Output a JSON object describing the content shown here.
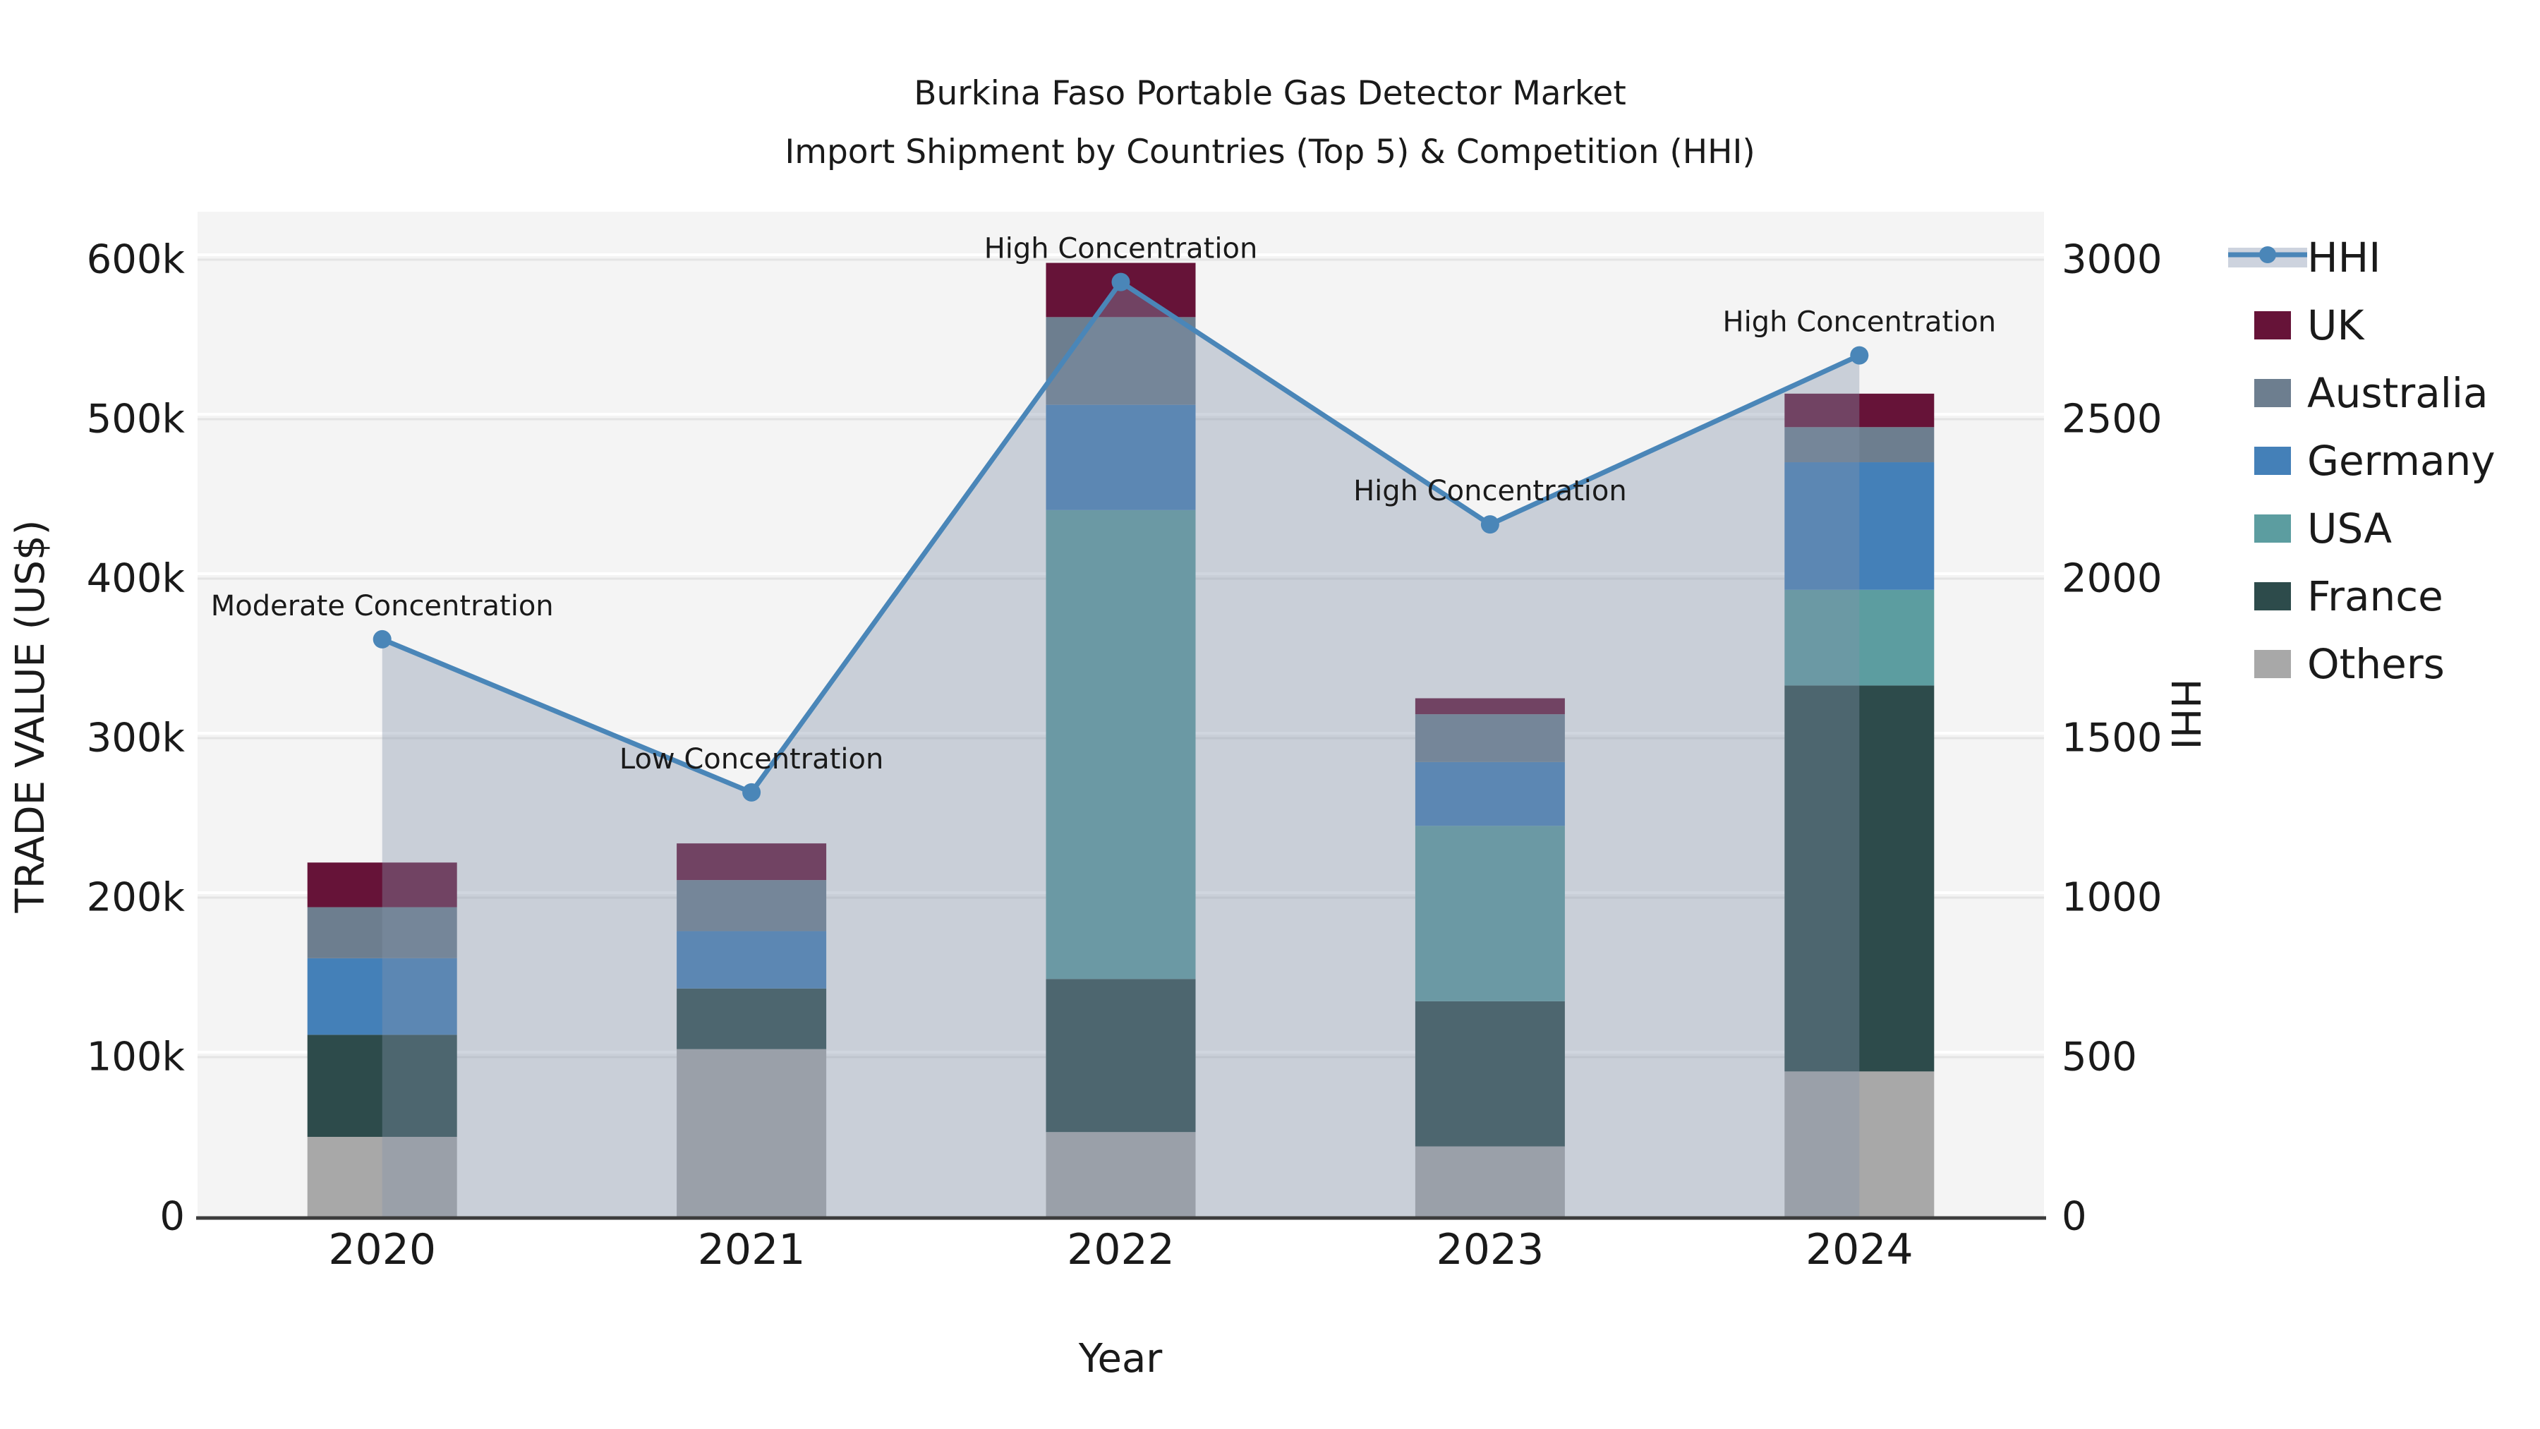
{
  "title": {
    "line1": "Burkina Faso Portable Gas Detector Market",
    "line2": "Import Shipment by Countries (Top 5) & Competition (HHI)"
  },
  "axes": {
    "y_left_label": "TRADE VALUE (US$)",
    "y_right_label": "HHI",
    "x_label": "Year",
    "y_left_ticks": [
      "0",
      "100k",
      "200k",
      "300k",
      "400k",
      "500k",
      "600k"
    ],
    "y_right_ticks": [
      "0",
      "500",
      "1000",
      "1500",
      "2000",
      "2500",
      "3000"
    ]
  },
  "legend": {
    "items": [
      {
        "label": "HHI",
        "swatch": "area-line"
      },
      {
        "label": "UK",
        "swatch": "box"
      },
      {
        "label": "Australia",
        "swatch": "box"
      },
      {
        "label": "Germany",
        "swatch": "box"
      },
      {
        "label": "USA",
        "swatch": "box"
      },
      {
        "label": "France",
        "swatch": "box"
      },
      {
        "label": "Others",
        "swatch": "box"
      }
    ]
  },
  "colors": {
    "plot_bg": "#f4f4f4",
    "grid_gray": "#e4e4e4",
    "grid_white": "#ffffff",
    "axis_line": "#3c3c3c",
    "text": "#1a1a1a",
    "hhi_line": "#4a86b8",
    "hhi_area": "rgba(132,146,172,0.38)",
    "legend_area_band": "#cdd3de"
  },
  "chart_data": {
    "type": "bar",
    "subtype": "stacked bars with overlaid line (dual axis)",
    "categories": [
      "2020",
      "2021",
      "2022",
      "2023",
      "2024"
    ],
    "values_unit": "thousand US$",
    "series": [
      {
        "name": "Others",
        "color": "#a8a8a8",
        "values": [
          50,
          105,
          53,
          44,
          91
        ]
      },
      {
        "name": "France",
        "color": "#2d4b4b",
        "values": [
          64,
          38,
          96,
          91,
          242
        ]
      },
      {
        "name": "USA",
        "color": "#5c9da0",
        "values": [
          0,
          0,
          294,
          110,
          60
        ]
      },
      {
        "name": "Germany",
        "color": "#4480b8",
        "values": [
          48,
          36,
          66,
          40,
          80
        ]
      },
      {
        "name": "Australia",
        "color": "#6d7e8f",
        "values": [
          32,
          32,
          55,
          30,
          22
        ]
      },
      {
        "name": "UK",
        "color": "#661338",
        "values": [
          28,
          23,
          34,
          10,
          21
        ]
      }
    ],
    "stack_order": "bottom to top as listed",
    "line": {
      "name": "HHI",
      "color": "#4a86b8",
      "axis": "right",
      "values": [
        1810,
        1330,
        2930,
        2170,
        2700
      ],
      "area_fill": true
    },
    "annotations": [
      {
        "category": "2020",
        "text": "Moderate Concentration"
      },
      {
        "category": "2021",
        "text": "Low Concentration"
      },
      {
        "category": "2022",
        "text": "High Concentration"
      },
      {
        "category": "2023",
        "text": "High Concentration"
      },
      {
        "category": "2024",
        "text": "High Concentration"
      }
    ],
    "title": "Burkina Faso Portable Gas Detector Market — Import Shipment by Countries (Top 5) & Competition (HHI)",
    "xlabel": "Year",
    "ylabel_left": "TRADE VALUE (US$)",
    "ylabel_right": "HHI",
    "ylim_left": [
      0,
      630000
    ],
    "ylim_right": [
      0,
      3150
    ],
    "grid": true,
    "legend_position": "right"
  }
}
